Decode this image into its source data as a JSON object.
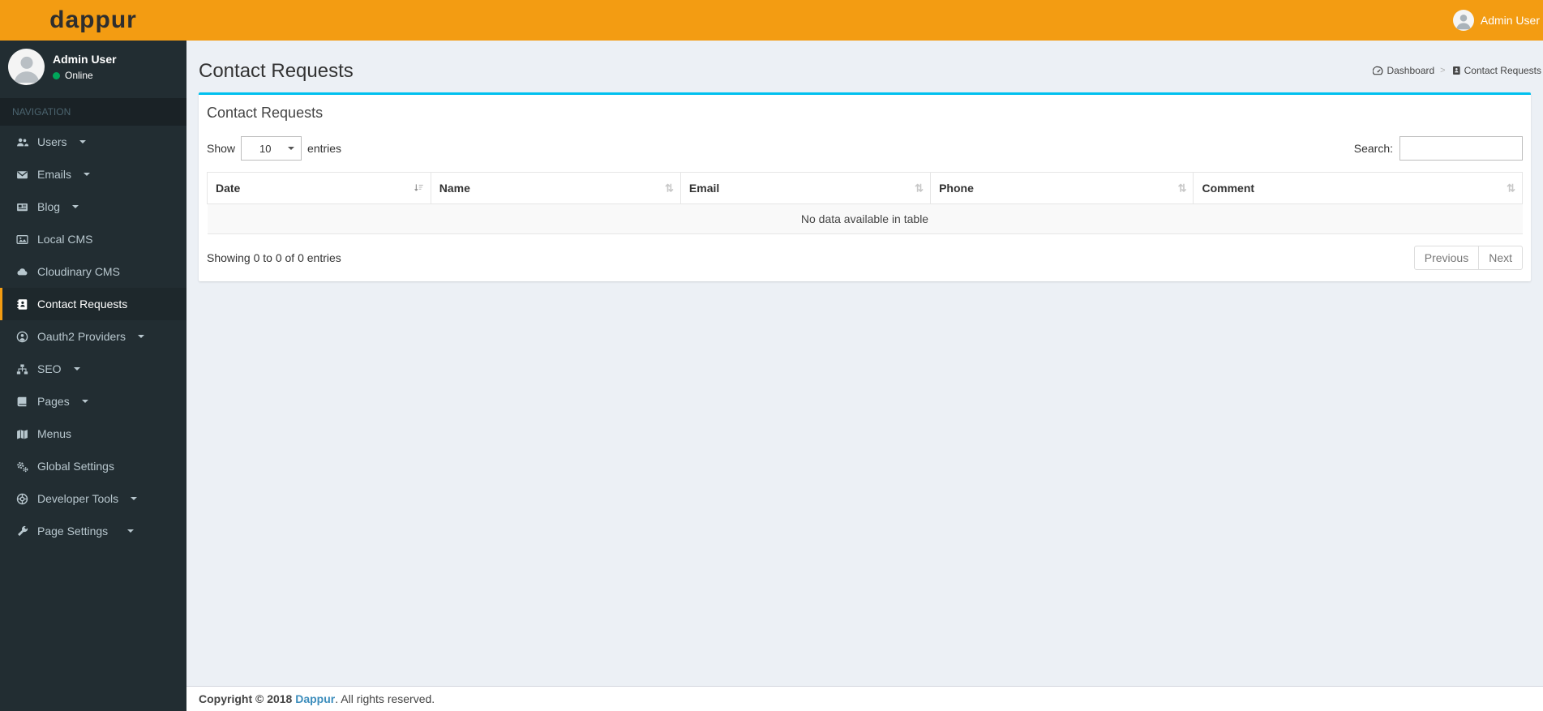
{
  "colors": {
    "navbar": "#f39c12",
    "sidebar": "#222d32",
    "active_accent": "#f39c12",
    "box_top_border": "#00c0ef",
    "link": "#3c8dbc",
    "online_dot": "#00a65a"
  },
  "navbar": {
    "logo": "dappur",
    "user_name": "Admin User"
  },
  "sidebar": {
    "user_name": "Admin User",
    "user_status": "Online",
    "section_header": "NAVIGATION",
    "items": [
      {
        "label": "Users",
        "icon": "users-icon",
        "has_submenu": true,
        "active": false
      },
      {
        "label": "Emails",
        "icon": "envelope-icon",
        "has_submenu": true,
        "active": false
      },
      {
        "label": "Blog",
        "icon": "newspaper-icon",
        "has_submenu": true,
        "active": false
      },
      {
        "label": "Local CMS",
        "icon": "image-icon",
        "has_submenu": false,
        "active": false
      },
      {
        "label": "Cloudinary CMS",
        "icon": "cloud-icon",
        "has_submenu": false,
        "active": false
      },
      {
        "label": "Contact Requests",
        "icon": "address-book-icon",
        "has_submenu": false,
        "active": true
      },
      {
        "label": "Oauth2 Providers",
        "icon": "user-circle-icon",
        "has_submenu": true,
        "active": false
      },
      {
        "label": "SEO",
        "icon": "sitemap-icon",
        "has_submenu": true,
        "active": false
      },
      {
        "label": "Pages",
        "icon": "book-icon",
        "has_submenu": true,
        "active": false
      },
      {
        "label": "Menus",
        "icon": "map-icon",
        "has_submenu": false,
        "active": false
      },
      {
        "label": "Global Settings",
        "icon": "gears-icon",
        "has_submenu": false,
        "active": false
      },
      {
        "label": "Developer Tools",
        "icon": "developer-tools-icon",
        "has_submenu": true,
        "active": false
      },
      {
        "label": "Page Settings",
        "icon": "wrench-icon",
        "has_submenu": true,
        "active": false
      }
    ]
  },
  "page": {
    "title": "Contact Requests",
    "breadcrumb": [
      {
        "label": "Dashboard",
        "icon": "dashboard-icon"
      },
      {
        "label": "Contact Requests",
        "icon": "address-book-icon"
      }
    ],
    "breadcrumb_separator": ">"
  },
  "box": {
    "title": "Contact Requests",
    "show_label": "Show",
    "page_length": "10",
    "entries_label": "entries",
    "search_label": "Search:",
    "search_value": "",
    "table": {
      "columns": [
        "Date",
        "Name",
        "Email",
        "Phone",
        "Comment"
      ],
      "empty_message": "No data available in table"
    },
    "info": "Showing 0 to 0 of 0 entries",
    "pagination": {
      "previous": "Previous",
      "next": "Next"
    }
  },
  "footer": {
    "copyright": "Copyright © 2018",
    "brand": "Dappur",
    "suffix": ". All rights reserved."
  }
}
